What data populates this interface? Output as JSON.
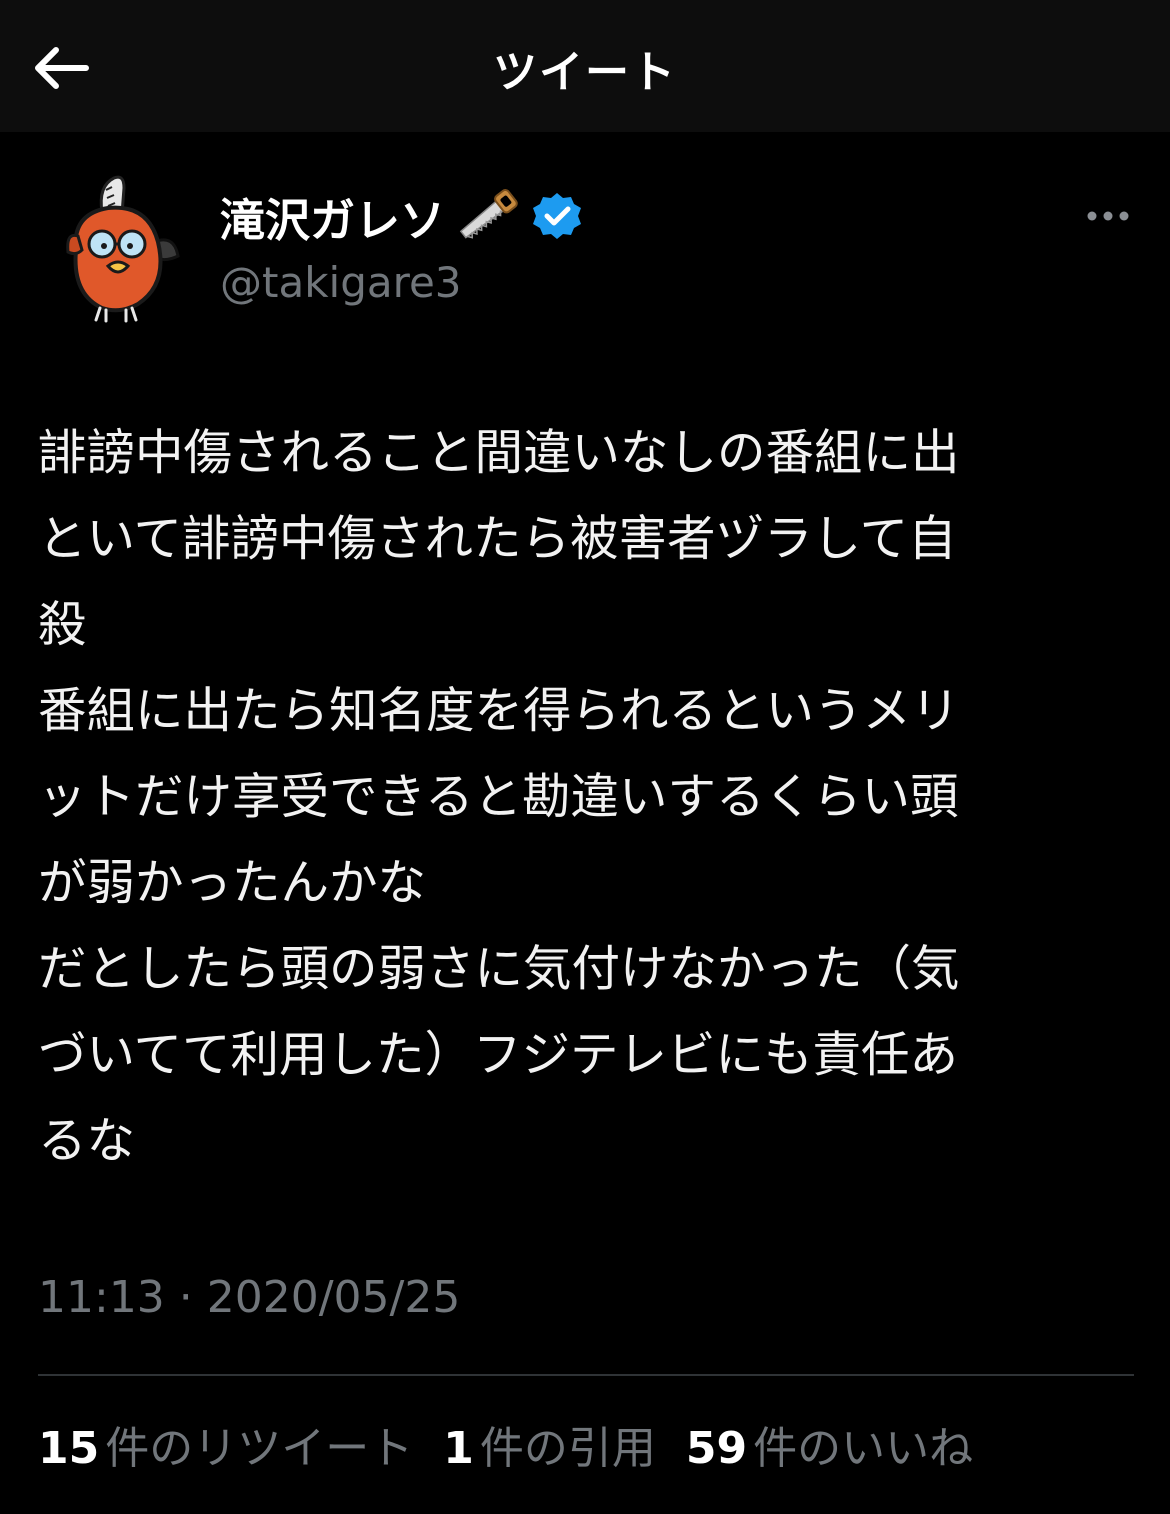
{
  "header": {
    "title": "ツイート",
    "back_icon": "arrow-left-icon"
  },
  "author": {
    "display_name": "滝沢ガレソ",
    "name_emoji": "saw-icon",
    "verified_icon": "verified-badge-icon",
    "verified_color": "#1d9bf0",
    "handle": "@takigare3",
    "avatar": "avatar-chainsaw-dog-character"
  },
  "more_icon": "more-options-icon",
  "tweet": {
    "lines": [
      "誹謗中傷されること間違いなしの番組に出",
      "といて誹謗中傷されたら被害者ヅラして自",
      "殺",
      "番組に出たら知名度を得られるというメリ",
      "ットだけ享受できると勘違いするくらい頭",
      "が弱かったんかな",
      "だとしたら頭の弱さに気付けなかった（気",
      "づいてて利用した）フジテレビにも責任あ",
      "るな"
    ]
  },
  "timestamp": "11:13 · 2020/05/25",
  "stats": [
    {
      "count": "15",
      "label": "件のリツイート"
    },
    {
      "count": "1",
      "label": "件の引用"
    },
    {
      "count": "59",
      "label": "件のいいね"
    }
  ],
  "colors": {
    "background": "#000000",
    "header_background": "#0d0d0d",
    "text_primary": "#ffffff",
    "text_secondary": "#71767b",
    "divider": "#2f3336"
  }
}
